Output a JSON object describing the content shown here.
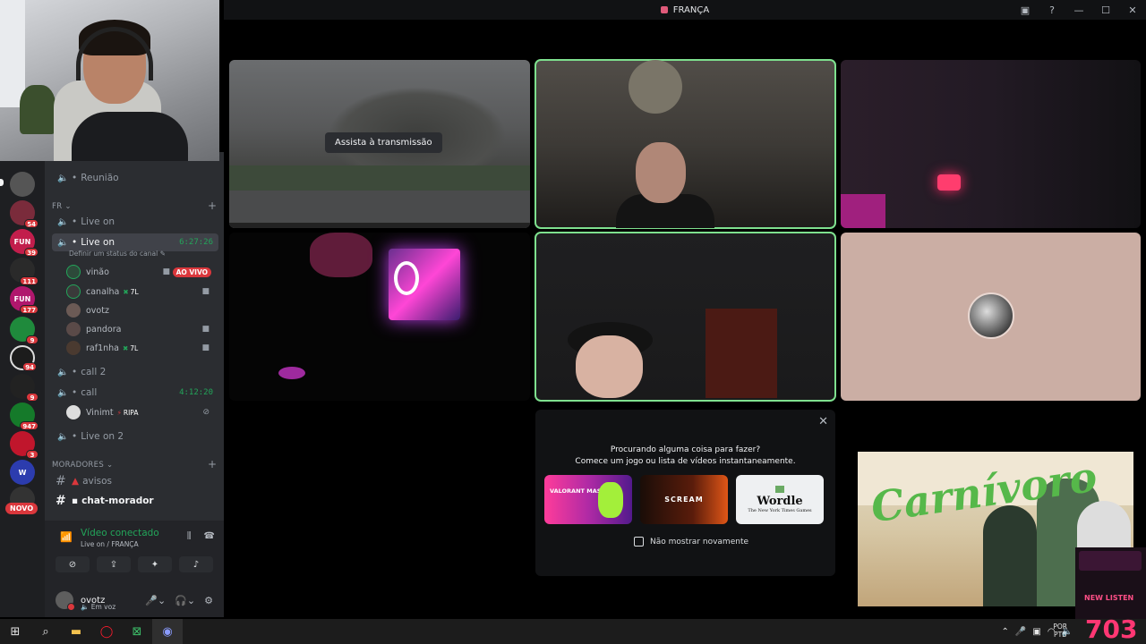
{
  "window": {
    "title": "FRANÇA"
  },
  "servers": [
    {
      "badge": "54",
      "color": "#7a2b3b"
    },
    {
      "badge": "39",
      "color": "#c21e4c",
      "label": "FUN"
    },
    {
      "badge": "111",
      "color": "#2a2a2a"
    },
    {
      "badge": "177",
      "color": "#b0176d",
      "label": "FUN"
    },
    {
      "badge": "9",
      "color": "#1f8a3c"
    },
    {
      "badge": "94",
      "color": "#1c1c1c"
    },
    {
      "badge": "9",
      "color": "#222"
    },
    {
      "badge": "947",
      "color": "#157a2a"
    },
    {
      "badge": "3",
      "color": "#c0162c"
    },
    {
      "badge": "",
      "color": "#2c3cae",
      "label": "W"
    }
  ],
  "novo_badge": "NOVO",
  "channels": {
    "reuniao": "Reunião",
    "cat_fr": "FR",
    "live_on": "Live on",
    "live_on_active": "Live on",
    "live_on_active_time": "6:27:26",
    "status_placeholder": "Definir um status do canal",
    "users": [
      {
        "name": "vinão",
        "live": "AO VIVO"
      },
      {
        "name": "canalha",
        "tag": "7L"
      },
      {
        "name": "ovotz"
      },
      {
        "name": "pandora"
      },
      {
        "name": "raf1nha",
        "tag": "7L"
      }
    ],
    "call2": "call 2",
    "call": "call",
    "call_time": "4:12:20",
    "call_user": {
      "name": "Vinimt",
      "tag": "RIPA"
    },
    "live_on2": "Live on 2",
    "cat_moradores": "MORADORES",
    "avisos": "avisos",
    "chat_morador": "chat-morador"
  },
  "voice": {
    "title": "Vídeo conectado",
    "subtitle": "Live on / FRANÇA"
  },
  "user": {
    "name": "ovotz",
    "status": "Em voz"
  },
  "stage": {
    "watch_stream": "Assista à transmissão"
  },
  "activity": {
    "line1": "Procurando alguma coisa para fazer?",
    "line2": "Comece um jogo ou lista de vídeos instantaneamente.",
    "card1": "VALORANT MASTERS",
    "card2": "SCREAM",
    "card3": "Wordle",
    "card3_sub": "The New York Times Games",
    "checkbox_label": "Não mostrar novamente"
  },
  "overlay": {
    "ad_word": "Carnívoro",
    "widget_label": "NEW LISTEN",
    "widget_count": "703"
  },
  "taskbar": {
    "lang_top": "POR",
    "lang_bottom": "PTB"
  },
  "colors": {
    "accent_green": "#23a55a",
    "danger": "#da373c",
    "speaking": "#7ee08e"
  }
}
